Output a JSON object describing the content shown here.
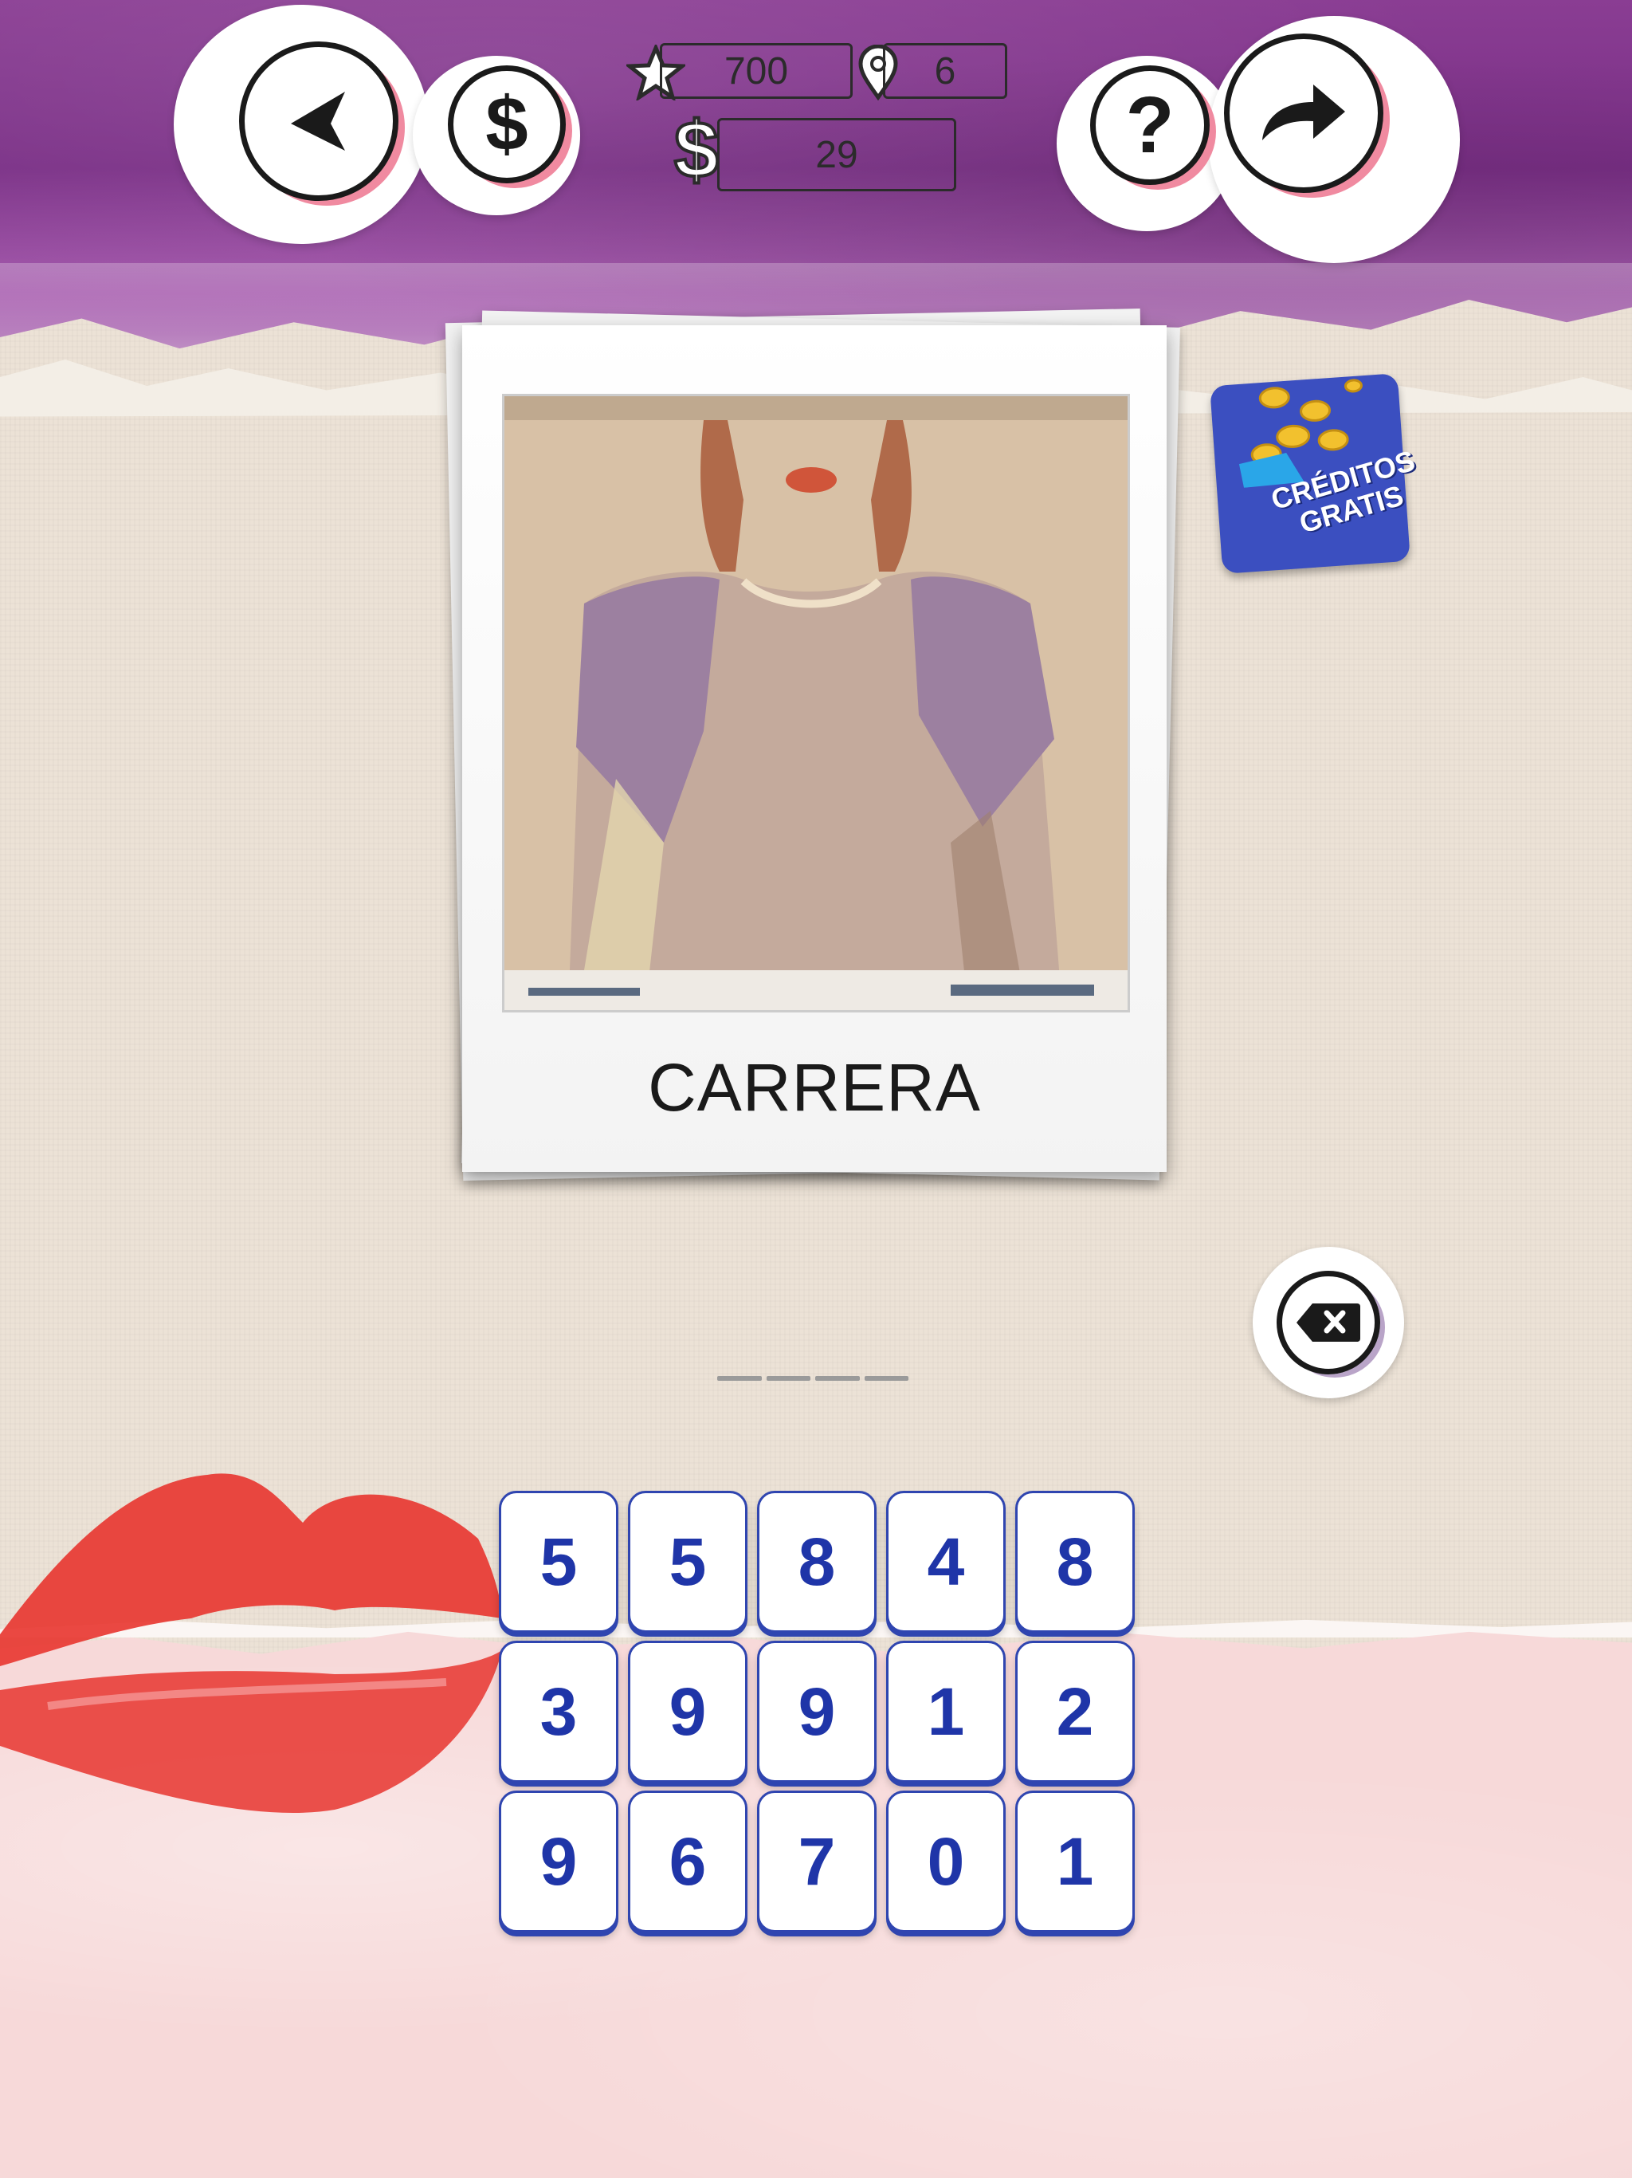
{
  "stats": {
    "stars": "700",
    "level": "6",
    "money": "29"
  },
  "photo": {
    "caption": "CARRERA"
  },
  "promo": {
    "line1": "CRÉDITOS",
    "line2": "GRATIS"
  },
  "keypad": {
    "keys": [
      "5",
      "5",
      "8",
      "4",
      "8",
      "3",
      "9",
      "9",
      "1",
      "2",
      "9",
      "6",
      "7",
      "0",
      "1"
    ]
  },
  "answer": {
    "slots": 4
  },
  "colors": {
    "header": "#7a2f86",
    "key_text": "#1f35a8",
    "promo": "#3b4fc0",
    "pink": "#f7d9d9"
  },
  "icons": {
    "back": "back-arrow-icon",
    "buy": "dollar-icon",
    "help": "question-icon",
    "share": "share-arrow-icon",
    "star": "star-icon",
    "level": "location-pin-icon",
    "money": "dollar-icon",
    "delete": "backspace-icon"
  }
}
